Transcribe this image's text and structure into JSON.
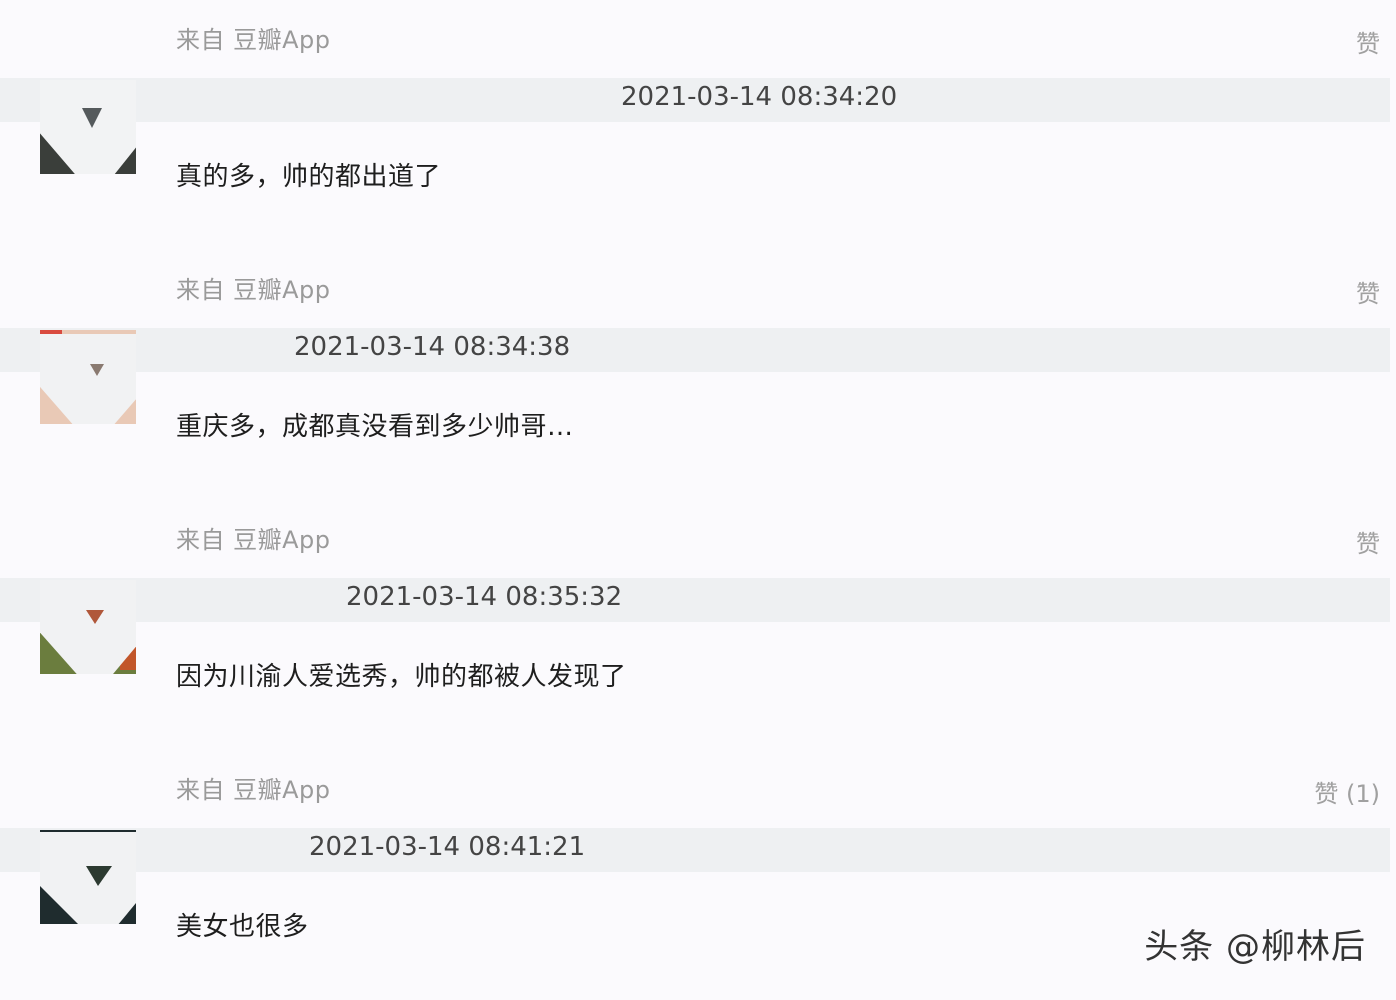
{
  "comments": [
    {
      "source": "来自 豆瓣App",
      "like": "赞",
      "timestamp": "2021-03-14 08:34:20",
      "text": "真的多，帅的都出道了",
      "avatar_color": "#3a3e3a"
    },
    {
      "source": "来自 豆瓣App",
      "like": "赞",
      "timestamp": "2021-03-14 08:34:38",
      "text": "重庆多，成都真没看到多少帅哥…",
      "avatar_color": "#e9c9b6"
    },
    {
      "source": "来自 豆瓣App",
      "like": "赞",
      "timestamp": "2021-03-14 08:35:32",
      "text": "因为川渝人爱选秀，帅的都被人发现了",
      "avatar_color": "#6b7d3e"
    },
    {
      "source": "来自 豆瓣App",
      "like": "赞 (1)",
      "timestamp": "2021-03-14 08:41:21",
      "text": "美女也很多",
      "avatar_color": "#1f2c2e"
    }
  ],
  "watermark": "头条 @柳林后"
}
